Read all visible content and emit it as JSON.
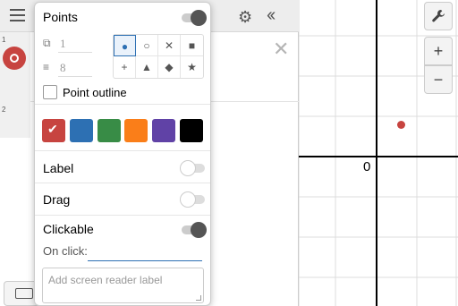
{
  "graph": {
    "origin_label": "0",
    "grid_color": "#dcdcdc",
    "axis_color": "#000000",
    "point_color": "#c74440"
  },
  "left_panel": {
    "row_numbers": [
      "1",
      "2"
    ],
    "icons": {
      "menu": "hamburger-menu-icon",
      "settings": "gear-icon",
      "collapse": "double-chevron-left-icon",
      "delete": "close-icon",
      "keyboard": "keyboard-icon"
    }
  },
  "right_controls": {
    "settings_icon": "wrench-icon",
    "zoom_in": "+",
    "zoom_out": "−"
  },
  "popup": {
    "points": {
      "title": "Points",
      "enabled": true,
      "opacity_value": "1",
      "size_value": "8",
      "style_options": [
        "●",
        "○",
        "✕",
        "■",
        "+",
        "▲",
        "◆",
        "★"
      ],
      "selected_style": "●",
      "outline_label": "Point outline",
      "outline_checked": false
    },
    "colors": {
      "options": [
        "#c74440",
        "#2d70b3",
        "#388c46",
        "#fa7e19",
        "#6042a6",
        "#000000"
      ],
      "selected": "#c74440"
    },
    "label": {
      "text": "Label",
      "enabled": false
    },
    "drag": {
      "text": "Drag",
      "enabled": false
    },
    "clickable": {
      "text": "Clickable",
      "enabled": true,
      "on_click_label": "On click:",
      "screen_reader_placeholder": "Add screen reader label"
    }
  }
}
